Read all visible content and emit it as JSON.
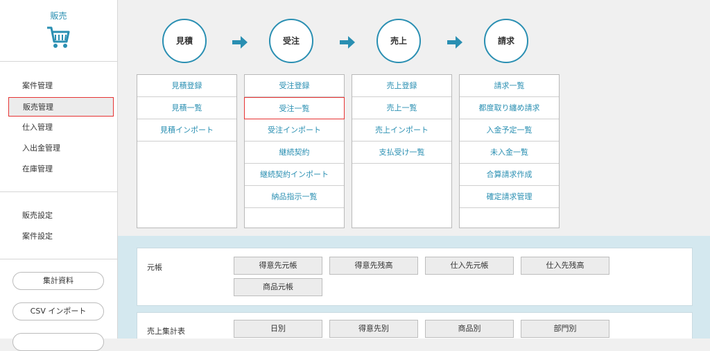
{
  "sidebar": {
    "title": "販売",
    "cart_icon": "cart-icon",
    "menu": [
      "案件管理",
      "販売管理",
      "仕入管理",
      "入出金管理",
      "在庫管理"
    ],
    "settings": [
      "販売設定",
      "案件設定"
    ],
    "buttons": [
      "集計資料",
      "CSV インポート"
    ]
  },
  "flow": {
    "steps": [
      "見積",
      "受注",
      "売上",
      "請求"
    ],
    "arrow_icon": "arrow-right-icon",
    "accent": "#2a8fb2",
    "columns": [
      [
        "見積登録",
        "見積一覧",
        "見積インポート"
      ],
      [
        "受注登録",
        "受注一覧",
        "受注インポート",
        "継続契約",
        "継続契約インポート",
        "納品指示一覧"
      ],
      [
        "売上登録",
        "売上一覧",
        "売上インポート",
        "支払受け一覧"
      ],
      [
        "請求一覧",
        "都度取り纏め請求",
        "入金予定一覧",
        "未入金一覧",
        "合算請求作成",
        "確定請求管理"
      ]
    ]
  },
  "ledger": {
    "label": "元帳",
    "buttons": [
      "得意先元帳",
      "得意先残高",
      "仕入先元帳",
      "仕入先残高",
      "商品元帳"
    ]
  },
  "sales_summary": {
    "label": "売上集計表",
    "buttons": [
      "日別",
      "得意先別",
      "商品別",
      "部門別"
    ]
  },
  "highlight_color": "#e63333"
}
